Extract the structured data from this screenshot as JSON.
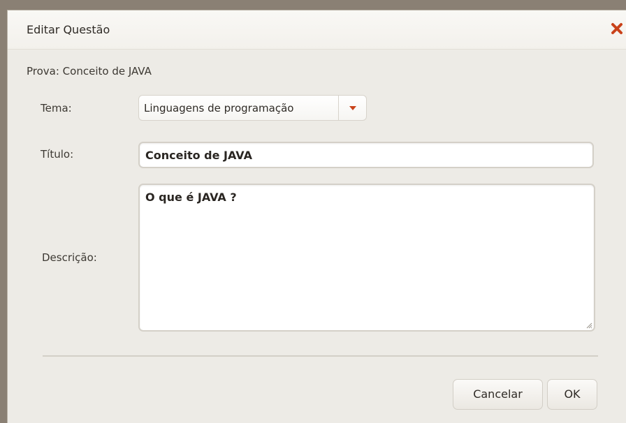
{
  "dialog": {
    "title": "Editar Questão",
    "close_icon": "close-x-icon",
    "close_color": "#c9421a"
  },
  "exam": {
    "label": "Prova: Conceito de JAVA"
  },
  "form": {
    "tema_label": "Tema:",
    "tema_value": "Linguagens de programação",
    "titulo_label": "Título:",
    "titulo_value": "Conceito de JAVA",
    "descricao_label": "Descrição:",
    "descricao_value": "O que é JAVA ?"
  },
  "footer": {
    "cancel_label": "Cancelar",
    "ok_label": "OK"
  }
}
